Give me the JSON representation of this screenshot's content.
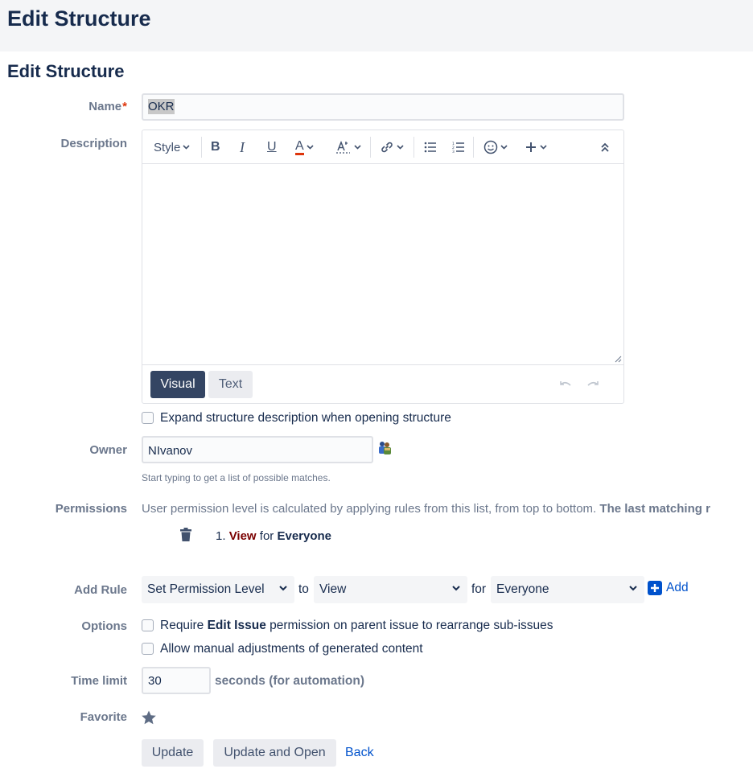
{
  "header": {
    "title": "Edit Structure"
  },
  "form": {
    "title": "Edit Structure",
    "name": {
      "label": "Name",
      "required_mark": "*",
      "value": "OKR"
    },
    "description": {
      "label": "Description",
      "toolbar": {
        "style_label": "Style",
        "bold": "B",
        "italic": "I",
        "underline": "U",
        "text_color": "A"
      },
      "mode_visual": "Visual",
      "mode_text": "Text"
    },
    "expand_checkbox_label": "Expand structure description when opening structure",
    "owner": {
      "label": "Owner",
      "value": "NIvanov",
      "help": "Start typing to get a list of possible matches."
    },
    "permissions": {
      "label": "Permissions",
      "intro": "User permission level is calculated by applying rules from this list, from top to bottom.",
      "intro_bold": "The last matching r",
      "rules": [
        {
          "index": "1.",
          "level": "View",
          "connector": "for",
          "who": "Everyone"
        }
      ]
    },
    "add_rule": {
      "label": "Add Rule",
      "type_select": "Set Permission Level",
      "to_text": "to",
      "level_select": "View",
      "for_text": "for",
      "who_select": "Everyone",
      "add_label": "Add"
    },
    "options": {
      "label": "Options",
      "opt1_pre": "Require",
      "opt1_bold": "Edit Issue",
      "opt1_post": "permission on parent issue to rearrange sub-issues",
      "opt2": "Allow manual adjustments of generated content"
    },
    "time_limit": {
      "label": "Time limit",
      "value": "30",
      "unit": "seconds (for automation)"
    },
    "favorite": {
      "label": "Favorite"
    },
    "buttons": {
      "update": "Update",
      "update_open": "Update and Open",
      "back": "Back"
    }
  },
  "colors": {
    "primary": "#0052cc",
    "dark_button": "#344563",
    "permission_level": "#7a0000",
    "required": "#de350b"
  }
}
